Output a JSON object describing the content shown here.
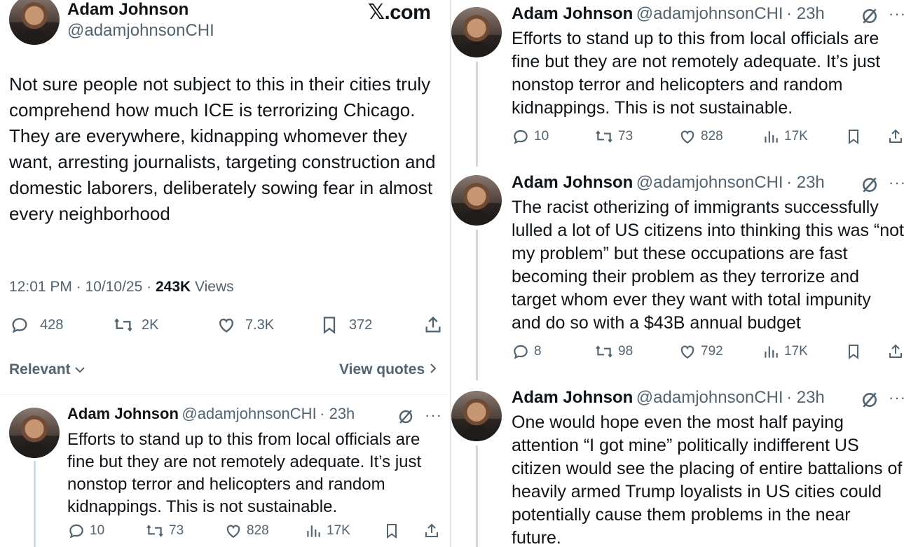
{
  "main_tweet": {
    "name": "Adam Johnson",
    "handle": "@adamjohnsonCHI",
    "site": "X.com",
    "site_x": "𝕏",
    "site_rest": ".com",
    "text": "Not sure people not subject to this in their cities truly comprehend how much ICE is terrorizing Chicago. They are everywhere, kidnapping whomever they want, arresting journalists, targeting construction and domestic laborers, deliberately sowing fear in almost every neighborhood",
    "time": "12:01 PM · 10/10/25 · ",
    "views_count": "243K",
    "views_label": " Views",
    "replies": "428",
    "reposts": "2K",
    "likes": "7.3K",
    "bookmarks": "372",
    "relevant_label": "Relevant",
    "view_quotes_label": "View quotes"
  },
  "replies": [
    {
      "name": "Adam Johnson",
      "handle": "@adamjohnsonCHI",
      "time": "· 23h",
      "text": "Efforts to stand up to this from local officials are fine but they are not remotely adequate. It’s just nonstop terror and helicopters and random kidnappings. This is not sustainable.",
      "replies": "10",
      "reposts": "73",
      "likes": "828",
      "views": "17K"
    },
    {
      "name": "Adam Johnson",
      "handle": "@adamjohnsonCHI",
      "time": "· 23h",
      "text": "Efforts to stand up to this from local officials are fine but they are not remotely adequate. It’s just nonstop terror and helicopters and random kidnappings. This is not sustainable.",
      "replies": "10",
      "reposts": "73",
      "likes": "828",
      "views": "17K"
    },
    {
      "name": "Adam Johnson",
      "handle": "@adamjohnsonCHI",
      "time": "· 23h",
      "text": "The racist otherizing of immigrants successfully lulled a lot of US citizens into thinking this was “not my problem” but these occupations are fast becoming their problem as they terrorize and target whom ever they want with total impunity and do so with a $43B annual budget",
      "replies": "8",
      "reposts": "98",
      "likes": "792",
      "views": "17K"
    },
    {
      "name": "Adam Johnson",
      "handle": "@adamjohnsonCHI",
      "time": "· 23h",
      "text": "One would hope even the most half paying attention “I got mine” politically indifferent US citizen would see the placing of entire battalions of heavily armed Trump loyalists in US cities could potentially cause them problems in the near future."
    }
  ],
  "icons": {
    "reply": "reply-icon",
    "repost": "repost-icon",
    "like": "heart-icon",
    "views": "views-icon",
    "bookmark": "bookmark-icon",
    "share": "share-icon",
    "grok": "grok-icon",
    "more": "more-icon"
  },
  "more_glyph": "···",
  "chevron_down": "⌄",
  "chevron_right": "›"
}
